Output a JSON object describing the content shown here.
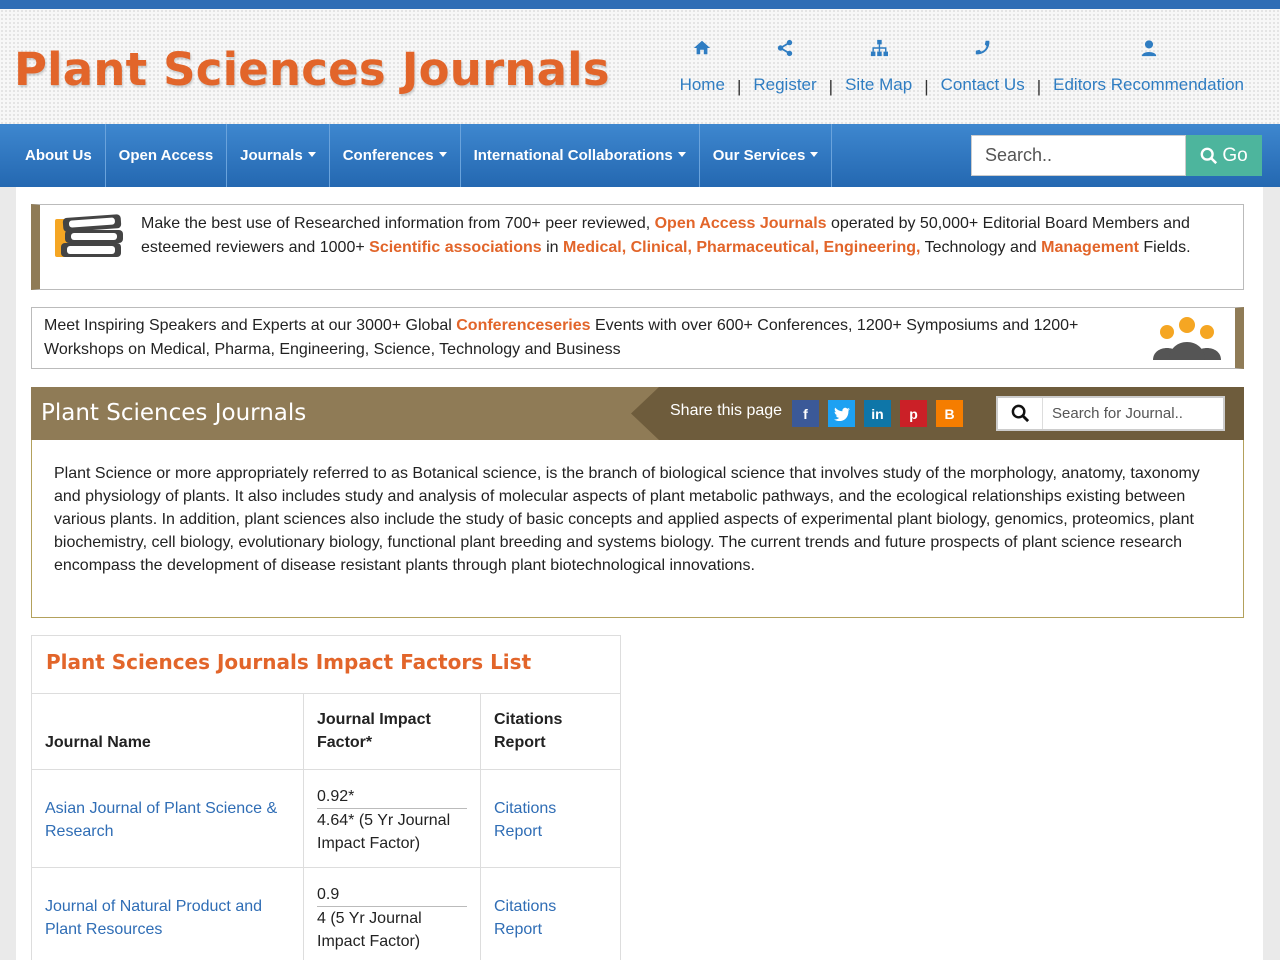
{
  "site": {
    "logo": "Plant Sciences Journals"
  },
  "top_links": [
    {
      "label": "Home",
      "icon": "home-icon"
    },
    {
      "label": "Register",
      "icon": "share-icon"
    },
    {
      "label": "Site Map",
      "icon": "sitemap-icon"
    },
    {
      "label": "Contact Us",
      "icon": "phone-icon"
    },
    {
      "label": "Editors Recommendation",
      "icon": "user-icon"
    }
  ],
  "nav": {
    "items": [
      "About Us",
      "Open Access",
      "Journals",
      "Conferences",
      "International Collaborations",
      "Our Services"
    ],
    "search_placeholder": "Search..",
    "go_label": "Go"
  },
  "info1": {
    "t1": "Make the best use of Researched information from 700+ peer reviewed, ",
    "h1": "Open Access Journals",
    "t2": " operated by 50,000+ Editorial Board Members and esteemed reviewers and 1000+ ",
    "h2": "Scientific associations",
    "t3": " in ",
    "h3": "Medical, Clinical, Pharmaceutical, Engineering,",
    "t4": " Technology and ",
    "h4": "Management",
    "t5": " Fields."
  },
  "info2": {
    "t1": "Meet Inspiring Speakers and Experts at our 3000+ Global ",
    "h1": "Conferenceseries",
    "t2": " Events with over 600+ Conferences, 1200+ Symposiums and 1200+ Workshops on Medical, Pharma, Engineering, Science, Technology and Business"
  },
  "section": {
    "title": "Plant Sciences Journals",
    "share_label": "Share this page",
    "journal_search_placeholder": "Search for Journal..",
    "description": "Plant Science or more appropriately referred to as Botanical science, is the branch of biological science that involves study of the morphology, anatomy, taxonomy and physiology of plants. It also includes study and analysis of molecular aspects of plant metabolic pathways, and the ecological relationships existing between various plants. In addition, plant sciences also include the study of basic concepts and applied aspects of experimental plant biology, genomics, proteomics, plant biochemistry, cell biology, evolutionary biology, functional plant breeding and systems biology. The current trends and future prospects of plant science research encompass the development of disease resistant plants through plant biotechnological innovations."
  },
  "social": [
    {
      "name": "facebook-icon",
      "glyph": "f",
      "color": "#3b5998"
    },
    {
      "name": "twitter-icon",
      "glyph": "t",
      "color": "#1da1f2"
    },
    {
      "name": "linkedin-icon",
      "glyph": "in",
      "color": "#0e76a8"
    },
    {
      "name": "pinterest-icon",
      "glyph": "p",
      "color": "#cb2027"
    },
    {
      "name": "blogger-icon",
      "glyph": "B",
      "color": "#f57d00"
    }
  ],
  "impact_table": {
    "title": "Plant Sciences Journals Impact Factors List",
    "headers": [
      "Journal Name",
      "Journal Impact Factor*",
      "Citations Report"
    ],
    "rows": [
      {
        "journal": "Asian Journal of Plant Science & Research",
        "if": "0.92*",
        "if5": "4.64* (5 Yr Journal Impact Factor)",
        "citations": "Citations Report"
      },
      {
        "journal": "Journal of Natural Product and Plant Resources",
        "if": "0.9",
        "if5": "4 (5 Yr Journal Impact Factor)",
        "citations": "Citations Report"
      }
    ]
  },
  "colors": {
    "accent_orange": "#e2652a",
    "nav_blue": "#2f6db5",
    "brown": "#8f7b56",
    "go_green": "#4db59d"
  }
}
